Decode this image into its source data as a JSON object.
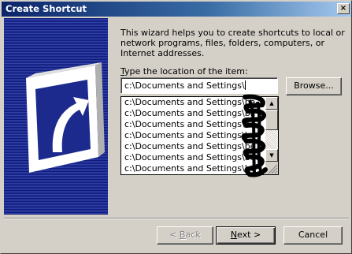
{
  "window": {
    "title": "Create Shortcut",
    "close_label": "×"
  },
  "intro_text": "This wizard helps you to create shortcuts to local or network programs, files, folders, computers, or Internet addresses.",
  "location": {
    "label_prefix": "",
    "label_access_key": "T",
    "label_rest": "ype the location of the item:",
    "value": "c:\\Documents and Settings\\"
  },
  "browse_label": "Browse...",
  "suggestions": [
    "c:\\Documents and Settings\\ba",
    "c:\\Documents and Settings\\ba",
    "c:\\Documents and Settings\\be",
    "c:\\Documents and Settings\\be",
    "c:\\Documents and Settings\\be",
    "c:\\Documents and Settings\\be",
    "c:\\Documents and Settings\\be"
  ],
  "buttons": {
    "back_lt": "< ",
    "back_key": "B",
    "back_rest": "ack",
    "next_key": "N",
    "next_rest": "ext >",
    "cancel": "Cancel"
  },
  "icons": {
    "banner": "shortcut-arrow-icon",
    "close": "close-icon",
    "scroll_up": "scroll-up-arrow-icon",
    "scroll_down": "scroll-down-arrow-icon"
  },
  "colors": {
    "title_bar": "#0a246a",
    "banner": "#1c2a8e",
    "dialog": "#d4d0c8"
  }
}
